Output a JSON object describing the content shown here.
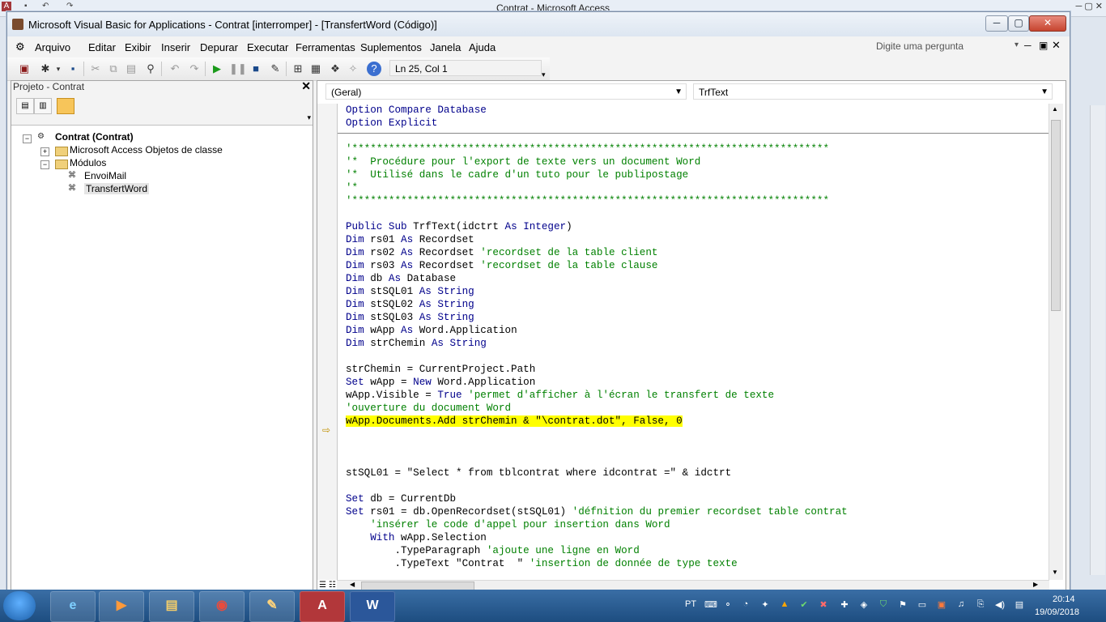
{
  "access": {
    "title": "Contrat - Microsoft Access",
    "right_controls": "─ ▢ ✕"
  },
  "vba": {
    "title": "Microsoft Visual Basic for Applications - Contrat [interromper] - [TransfertWord (Código)]",
    "menu": [
      "Arquivo",
      "Editar",
      "Exibir",
      "Inserir",
      "Depurar",
      "Executar",
      "Ferramentas",
      "Suplementos",
      "Janela",
      "Ajuda"
    ],
    "question_placeholder": "Digite uma pergunta",
    "cursor_position": "Ln 25, Col 1"
  },
  "project": {
    "title": "Projeto - Contrat",
    "close_glyph": "✕",
    "tree": {
      "root": "Contrat (Contrat)",
      "folder1": "Microsoft Access Objetos de classe",
      "folder2": "Módulos",
      "module1": "EnvoiMail",
      "module2": "TransfertWord"
    }
  },
  "code": {
    "object_combo": "(Geral)",
    "procedure_combo": "TrfText",
    "lines": [
      [
        {
          "t": "kw",
          "s": "Option Compare Database"
        }
      ],
      [
        {
          "t": "kw",
          "s": "Option Explicit"
        }
      ],
      [],
      [
        {
          "t": "cm",
          "s": "'******************************************************************************"
        }
      ],
      [
        {
          "t": "cm",
          "s": "'*  Procédure pour l'export de texte vers un document Word"
        }
      ],
      [
        {
          "t": "cm",
          "s": "'*  Utilisé dans le cadre d'un tuto pour le publipostage"
        }
      ],
      [
        {
          "t": "cm",
          "s": "'*"
        }
      ],
      [
        {
          "t": "cm",
          "s": "'******************************************************************************"
        }
      ],
      [],
      [
        {
          "t": "kw",
          "s": "Public Sub "
        },
        {
          "t": "tx",
          "s": "TrfText(idctrt "
        },
        {
          "t": "kw",
          "s": "As Integer"
        },
        {
          "t": "tx",
          "s": ")"
        }
      ],
      [
        {
          "t": "kw",
          "s": "Dim "
        },
        {
          "t": "tx",
          "s": "rs01 "
        },
        {
          "t": "kw",
          "s": "As "
        },
        {
          "t": "tx",
          "s": "Recordset"
        }
      ],
      [
        {
          "t": "kw",
          "s": "Dim "
        },
        {
          "t": "tx",
          "s": "rs02 "
        },
        {
          "t": "kw",
          "s": "As "
        },
        {
          "t": "tx",
          "s": "Recordset "
        },
        {
          "t": "cm",
          "s": "'recordset de la table client"
        }
      ],
      [
        {
          "t": "kw",
          "s": "Dim "
        },
        {
          "t": "tx",
          "s": "rs03 "
        },
        {
          "t": "kw",
          "s": "As "
        },
        {
          "t": "tx",
          "s": "Recordset "
        },
        {
          "t": "cm",
          "s": "'recordset de la table clause"
        }
      ],
      [
        {
          "t": "kw",
          "s": "Dim "
        },
        {
          "t": "tx",
          "s": "db "
        },
        {
          "t": "kw",
          "s": "As "
        },
        {
          "t": "tx",
          "s": "Database"
        }
      ],
      [
        {
          "t": "kw",
          "s": "Dim "
        },
        {
          "t": "tx",
          "s": "stSQL01 "
        },
        {
          "t": "kw",
          "s": "As String"
        }
      ],
      [
        {
          "t": "kw",
          "s": "Dim "
        },
        {
          "t": "tx",
          "s": "stSQL02 "
        },
        {
          "t": "kw",
          "s": "As String"
        }
      ],
      [
        {
          "t": "kw",
          "s": "Dim "
        },
        {
          "t": "tx",
          "s": "stSQL03 "
        },
        {
          "t": "kw",
          "s": "As String"
        }
      ],
      [
        {
          "t": "kw",
          "s": "Dim "
        },
        {
          "t": "tx",
          "s": "wApp "
        },
        {
          "t": "kw",
          "s": "As "
        },
        {
          "t": "tx",
          "s": "Word.Application"
        }
      ],
      [
        {
          "t": "kw",
          "s": "Dim "
        },
        {
          "t": "tx",
          "s": "strChemin "
        },
        {
          "t": "kw",
          "s": "As String"
        }
      ],
      [],
      [
        {
          "t": "tx",
          "s": "strChemin = CurrentProject.Path"
        }
      ],
      [
        {
          "t": "kw",
          "s": "Set "
        },
        {
          "t": "tx",
          "s": "wApp = "
        },
        {
          "t": "kw",
          "s": "New "
        },
        {
          "t": "tx",
          "s": "Word.Application"
        }
      ],
      [
        {
          "t": "tx",
          "s": "wApp.Visible = "
        },
        {
          "t": "kw",
          "s": "True "
        },
        {
          "t": "cm",
          "s": "'permet d'afficher à l'écran le transfert de texte"
        }
      ],
      [
        {
          "t": "cm",
          "s": "'ouverture du document Word"
        }
      ],
      [
        {
          "t": "hl",
          "s": "wApp.Documents.Add strChemin & \"\\contrat.dot\", False, 0"
        }
      ],
      [],
      [],
      [],
      [
        {
          "t": "tx",
          "s": "stSQL01 = \"Select * from tblcontrat where idcontrat =\" & idctrt"
        }
      ],
      [],
      [
        {
          "t": "kw",
          "s": "Set "
        },
        {
          "t": "tx",
          "s": "db = CurrentDb"
        }
      ],
      [
        {
          "t": "kw",
          "s": "Set "
        },
        {
          "t": "tx",
          "s": "rs01 = db.OpenRecordset(stSQL01) "
        },
        {
          "t": "cm",
          "s": "'défnition du premier recordset table contrat"
        }
      ],
      [
        {
          "t": "tx",
          "s": "    "
        },
        {
          "t": "cm",
          "s": "'insérer le code d'appel pour insertion dans Word"
        }
      ],
      [
        {
          "t": "tx",
          "s": "    "
        },
        {
          "t": "kw",
          "s": "With "
        },
        {
          "t": "tx",
          "s": "wApp.Selection"
        }
      ],
      [
        {
          "t": "tx",
          "s": "        .TypeParagraph "
        },
        {
          "t": "cm",
          "s": "'ajoute une ligne en Word"
        }
      ],
      [
        {
          "t": "tx",
          "s": "        .TypeText \"Contrat  \" "
        },
        {
          "t": "cm",
          "s": "'insertion de donnée de type texte"
        }
      ]
    ]
  },
  "taskbar": {
    "language": "PT",
    "time": "20:14",
    "date": "19/09/2018",
    "apps": [
      "Internet Explorer",
      "Media",
      "Explorer",
      "Chrome",
      "Paint",
      "Access",
      "Word"
    ]
  }
}
